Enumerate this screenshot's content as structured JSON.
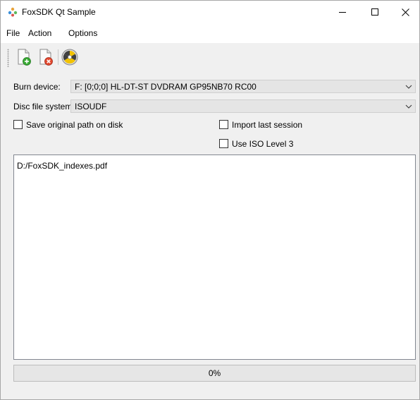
{
  "window": {
    "title": "FoxSDK Qt Sample",
    "icon": "foxsdk-app-icon",
    "controls": {
      "minimize_icon": "minimize-icon",
      "maximize_icon": "maximize-icon",
      "close_icon": "close-icon"
    }
  },
  "menu": {
    "items": [
      {
        "label": "File"
      },
      {
        "label": "Action"
      },
      {
        "label": "Options"
      }
    ]
  },
  "toolbar": {
    "buttons": [
      {
        "icon": "add-file-icon"
      },
      {
        "icon": "remove-file-icon"
      },
      {
        "icon": "burn-disc-icon"
      }
    ]
  },
  "form": {
    "burn_device": {
      "label": "Burn device:",
      "value": "F: [0;0;0] HL-DT-ST DVDRAM GP95NB70 RC00"
    },
    "file_system": {
      "label": "Disc file system:",
      "value": "ISOUDF"
    },
    "options": {
      "save_original_path": {
        "label": "Save original path on disk",
        "checked": false
      },
      "import_last_session": {
        "label": "Import last session",
        "checked": false
      },
      "use_iso_level_3": {
        "label": "Use ISO Level 3",
        "checked": false
      }
    }
  },
  "file_list": {
    "items": [
      "D:/FoxSDK_indexes.pdf"
    ]
  },
  "progress": {
    "percent": 0,
    "text": "0%"
  },
  "colors": {
    "window_bg": "#f0f0f0",
    "titlebar_bg": "#ffffff",
    "combo_bg": "#e5e5e5",
    "progress_fill": "#06b025"
  }
}
